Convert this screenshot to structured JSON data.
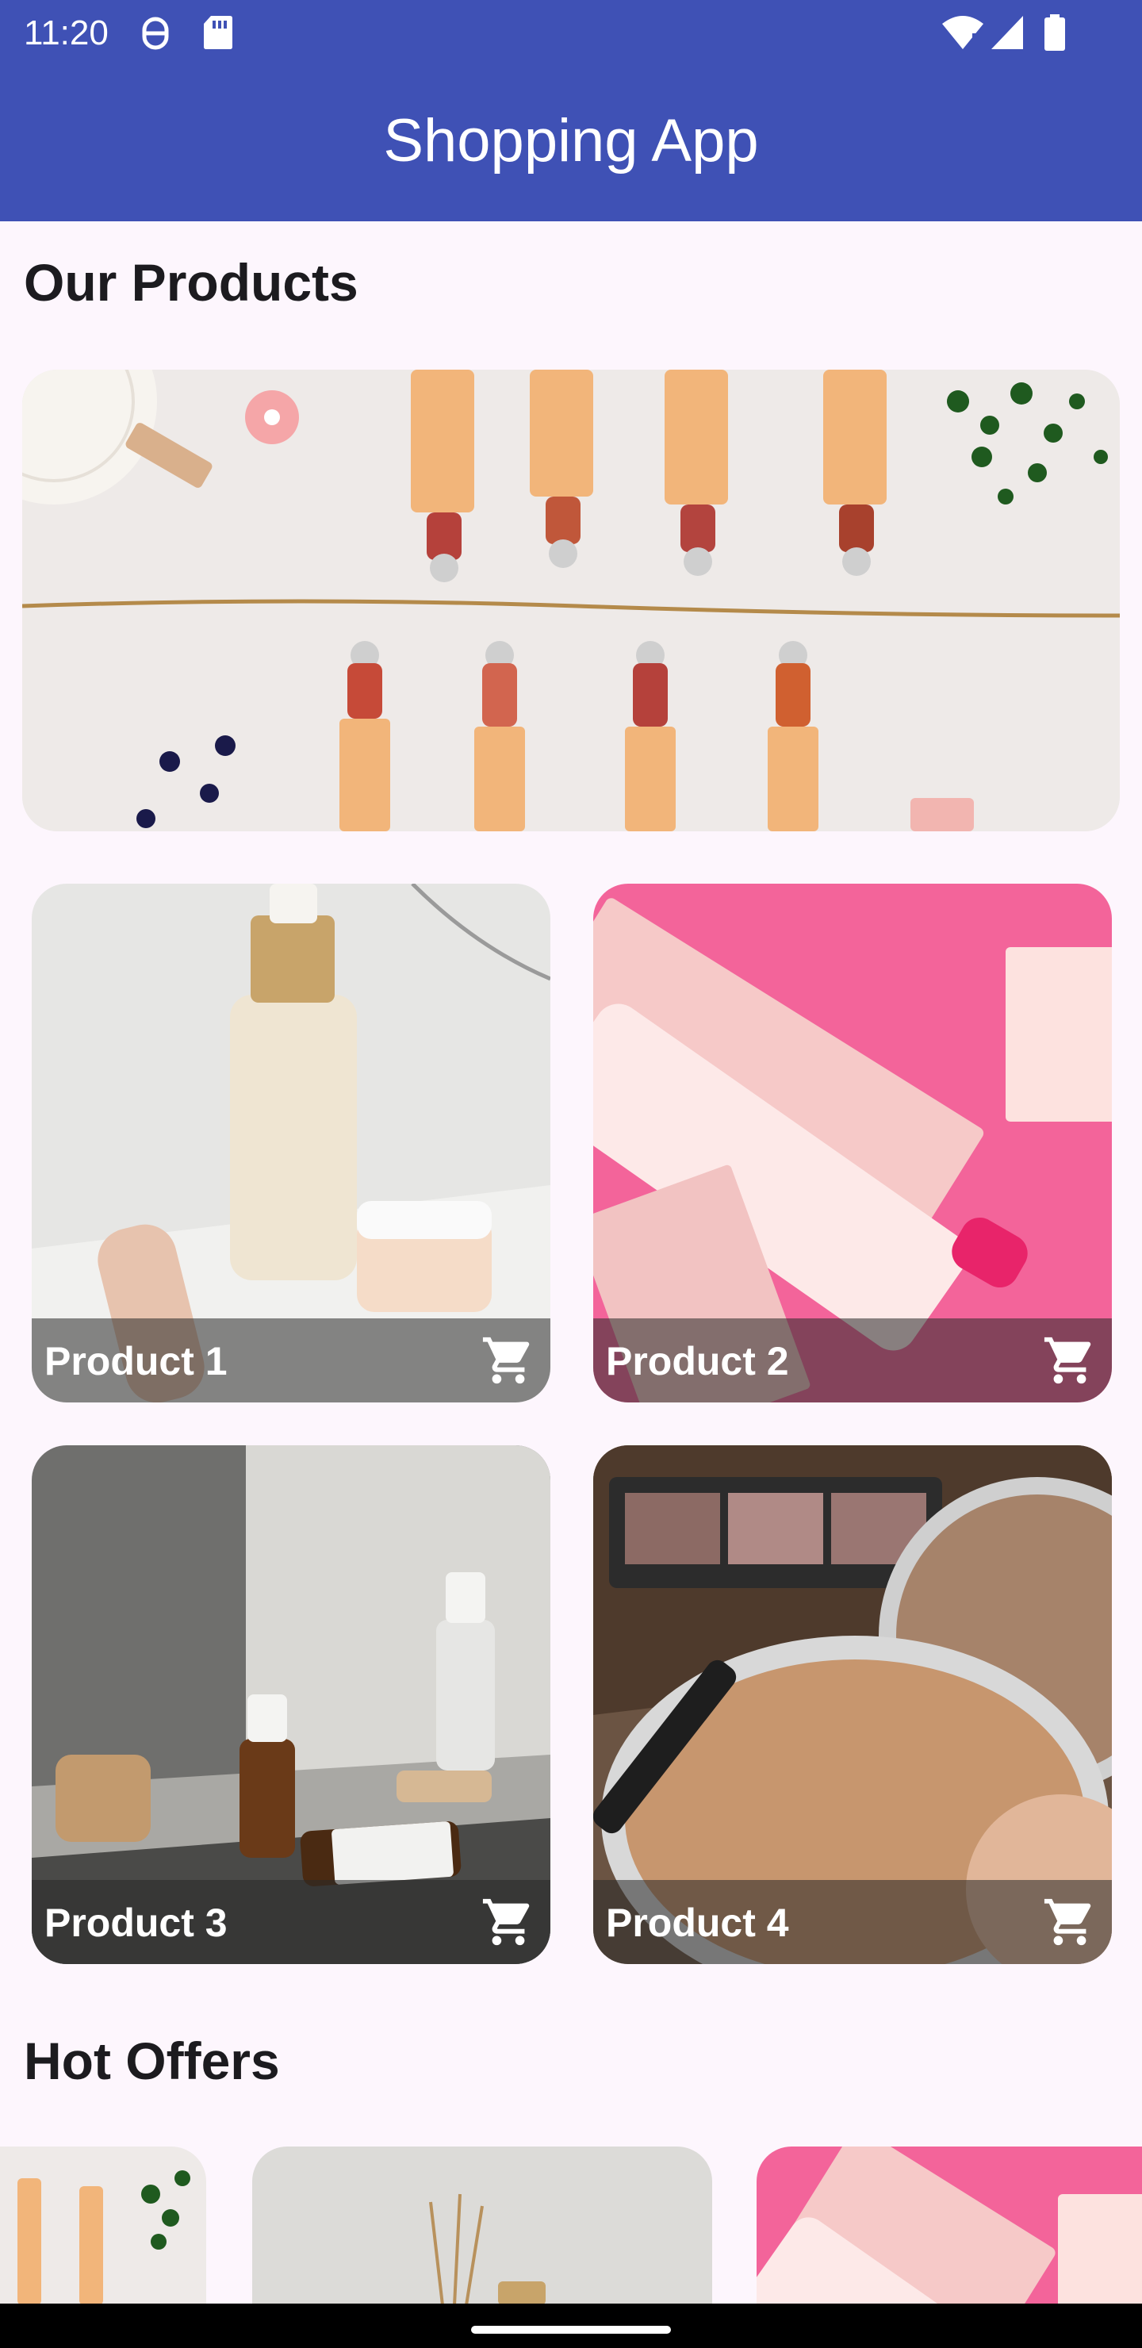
{
  "status_bar": {
    "time": "11:20",
    "icons": [
      "sim-toolkit-icon",
      "sd-card-icon",
      "wifi-icon",
      "cell-signal-icon",
      "battery-icon"
    ]
  },
  "app_bar": {
    "title": "Shopping App"
  },
  "sections": {
    "products_title": "Our Products",
    "offers_title": "Hot Offers"
  },
  "products": [
    {
      "name": "Product 1",
      "image": "skincare-bottle-and-jar"
    },
    {
      "name": "Product 2",
      "image": "pink-cosmetic-tubes"
    },
    {
      "name": "Product 3",
      "image": "dropper-bottles"
    },
    {
      "name": "Product 4",
      "image": "compact-powder"
    }
  ],
  "colors": {
    "primary": "#3f51b5",
    "background": "#fdf6fd",
    "card_overlay": "#282828"
  }
}
